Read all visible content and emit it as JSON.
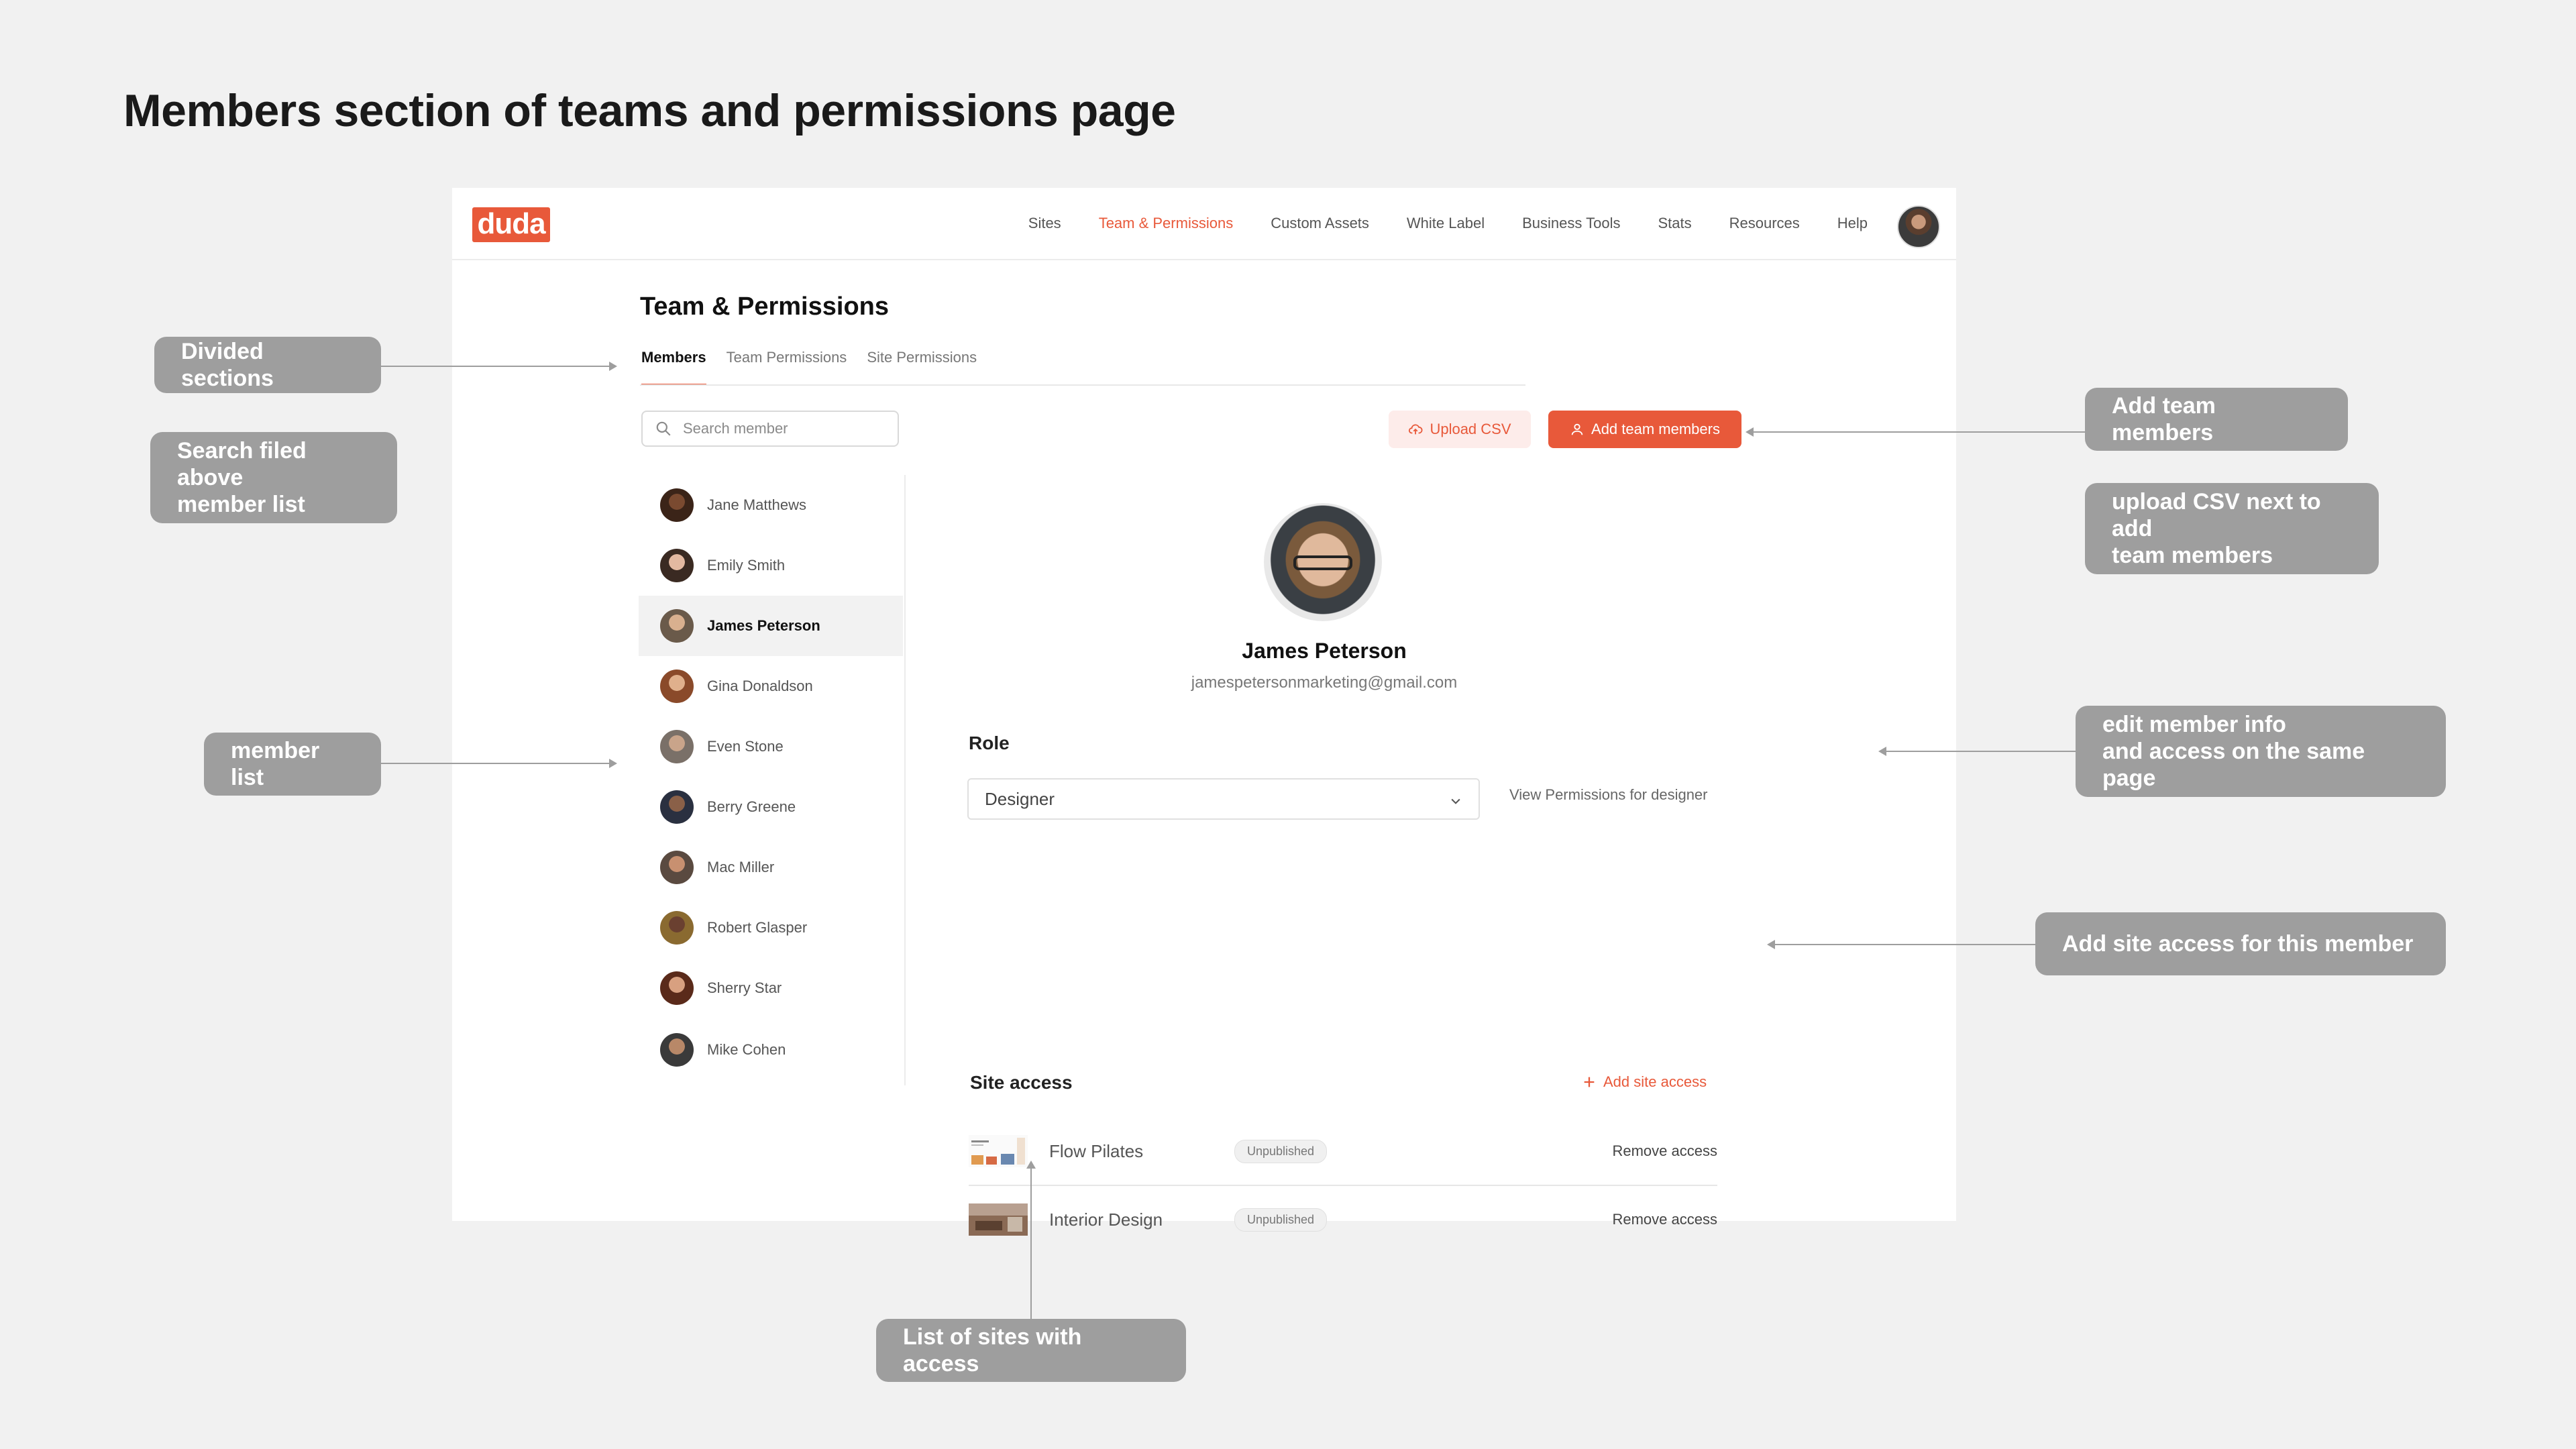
{
  "page_title": "Members section of teams and permissions page",
  "app": {
    "logo": "duda",
    "nav": [
      "Sites",
      "Team & Permissions",
      "Custom Assets",
      "White Label",
      "Business Tools",
      "Stats",
      "Resources",
      "Help"
    ],
    "nav_active": "Team & Permissions",
    "accent_color": "#e8593a"
  },
  "content": {
    "title": "Team & Permissions",
    "tabs": [
      "Members",
      "Team Permissions",
      "Site Permissions"
    ],
    "active_tab": "Members",
    "search_placeholder": "Search member",
    "upload_csv_label": "Upload CSV",
    "add_members_label": "Add team members"
  },
  "members": [
    {
      "name": "Jane Matthews"
    },
    {
      "name": "Emily Smith"
    },
    {
      "name": "James Peterson",
      "selected": true
    },
    {
      "name": "Gina Donaldson"
    },
    {
      "name": "Even Stone"
    },
    {
      "name": "Berry Greene"
    },
    {
      "name": "Mac Miller"
    },
    {
      "name": "Robert Glasper"
    },
    {
      "name": "Sherry Star"
    },
    {
      "name": "Mike Cohen"
    }
  ],
  "profile": {
    "name": "James Peterson",
    "email": "jamespetersonmarketing@gmail.com",
    "role_label": "Role",
    "role_value": "Designer",
    "view_permissions": "View Permissions for designer",
    "site_access_label": "Site access",
    "add_site_access": "Add site access",
    "sites": [
      {
        "name": "Flow Pilates",
        "status": "Unpublished",
        "action": "Remove access"
      },
      {
        "name": "Interior Design",
        "status": "Unpublished",
        "action": "Remove access"
      }
    ]
  },
  "annotations": {
    "divided_sections": "Divided sections",
    "search_field_1": "Search filed above",
    "search_field_2": "member list",
    "member_list": "member list",
    "add_team_members": "Add team members",
    "upload_csv_1": "upload CSV next to add",
    "upload_csv_2": "team members",
    "edit_member_1": "edit member info",
    "edit_member_2": "and access on the same page",
    "add_site_access": "Add site access for this member",
    "list_of_sites": "List of sites with access"
  }
}
